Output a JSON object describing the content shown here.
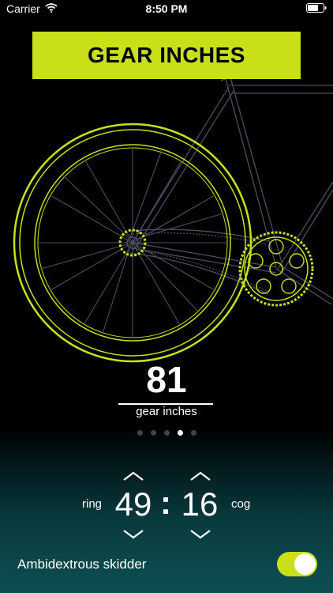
{
  "status_bar": {
    "carrier": "Carrier",
    "time": "8:50 PM"
  },
  "title": "GEAR INCHES",
  "result": {
    "value": "81",
    "label": "gear inches"
  },
  "pager": {
    "count": 5,
    "active_index": 3
  },
  "gear_picker": {
    "ring_label": "ring",
    "ring_value": "49",
    "separator": ":",
    "cog_value": "16",
    "cog_label": "cog"
  },
  "skidder": {
    "label": "Ambidextrous skidder",
    "enabled": true
  },
  "colors": {
    "accent": "#c8e018",
    "frame_stroke": "#4a5060",
    "background": "#000000",
    "gradient_bottom": "#0d4f53"
  }
}
